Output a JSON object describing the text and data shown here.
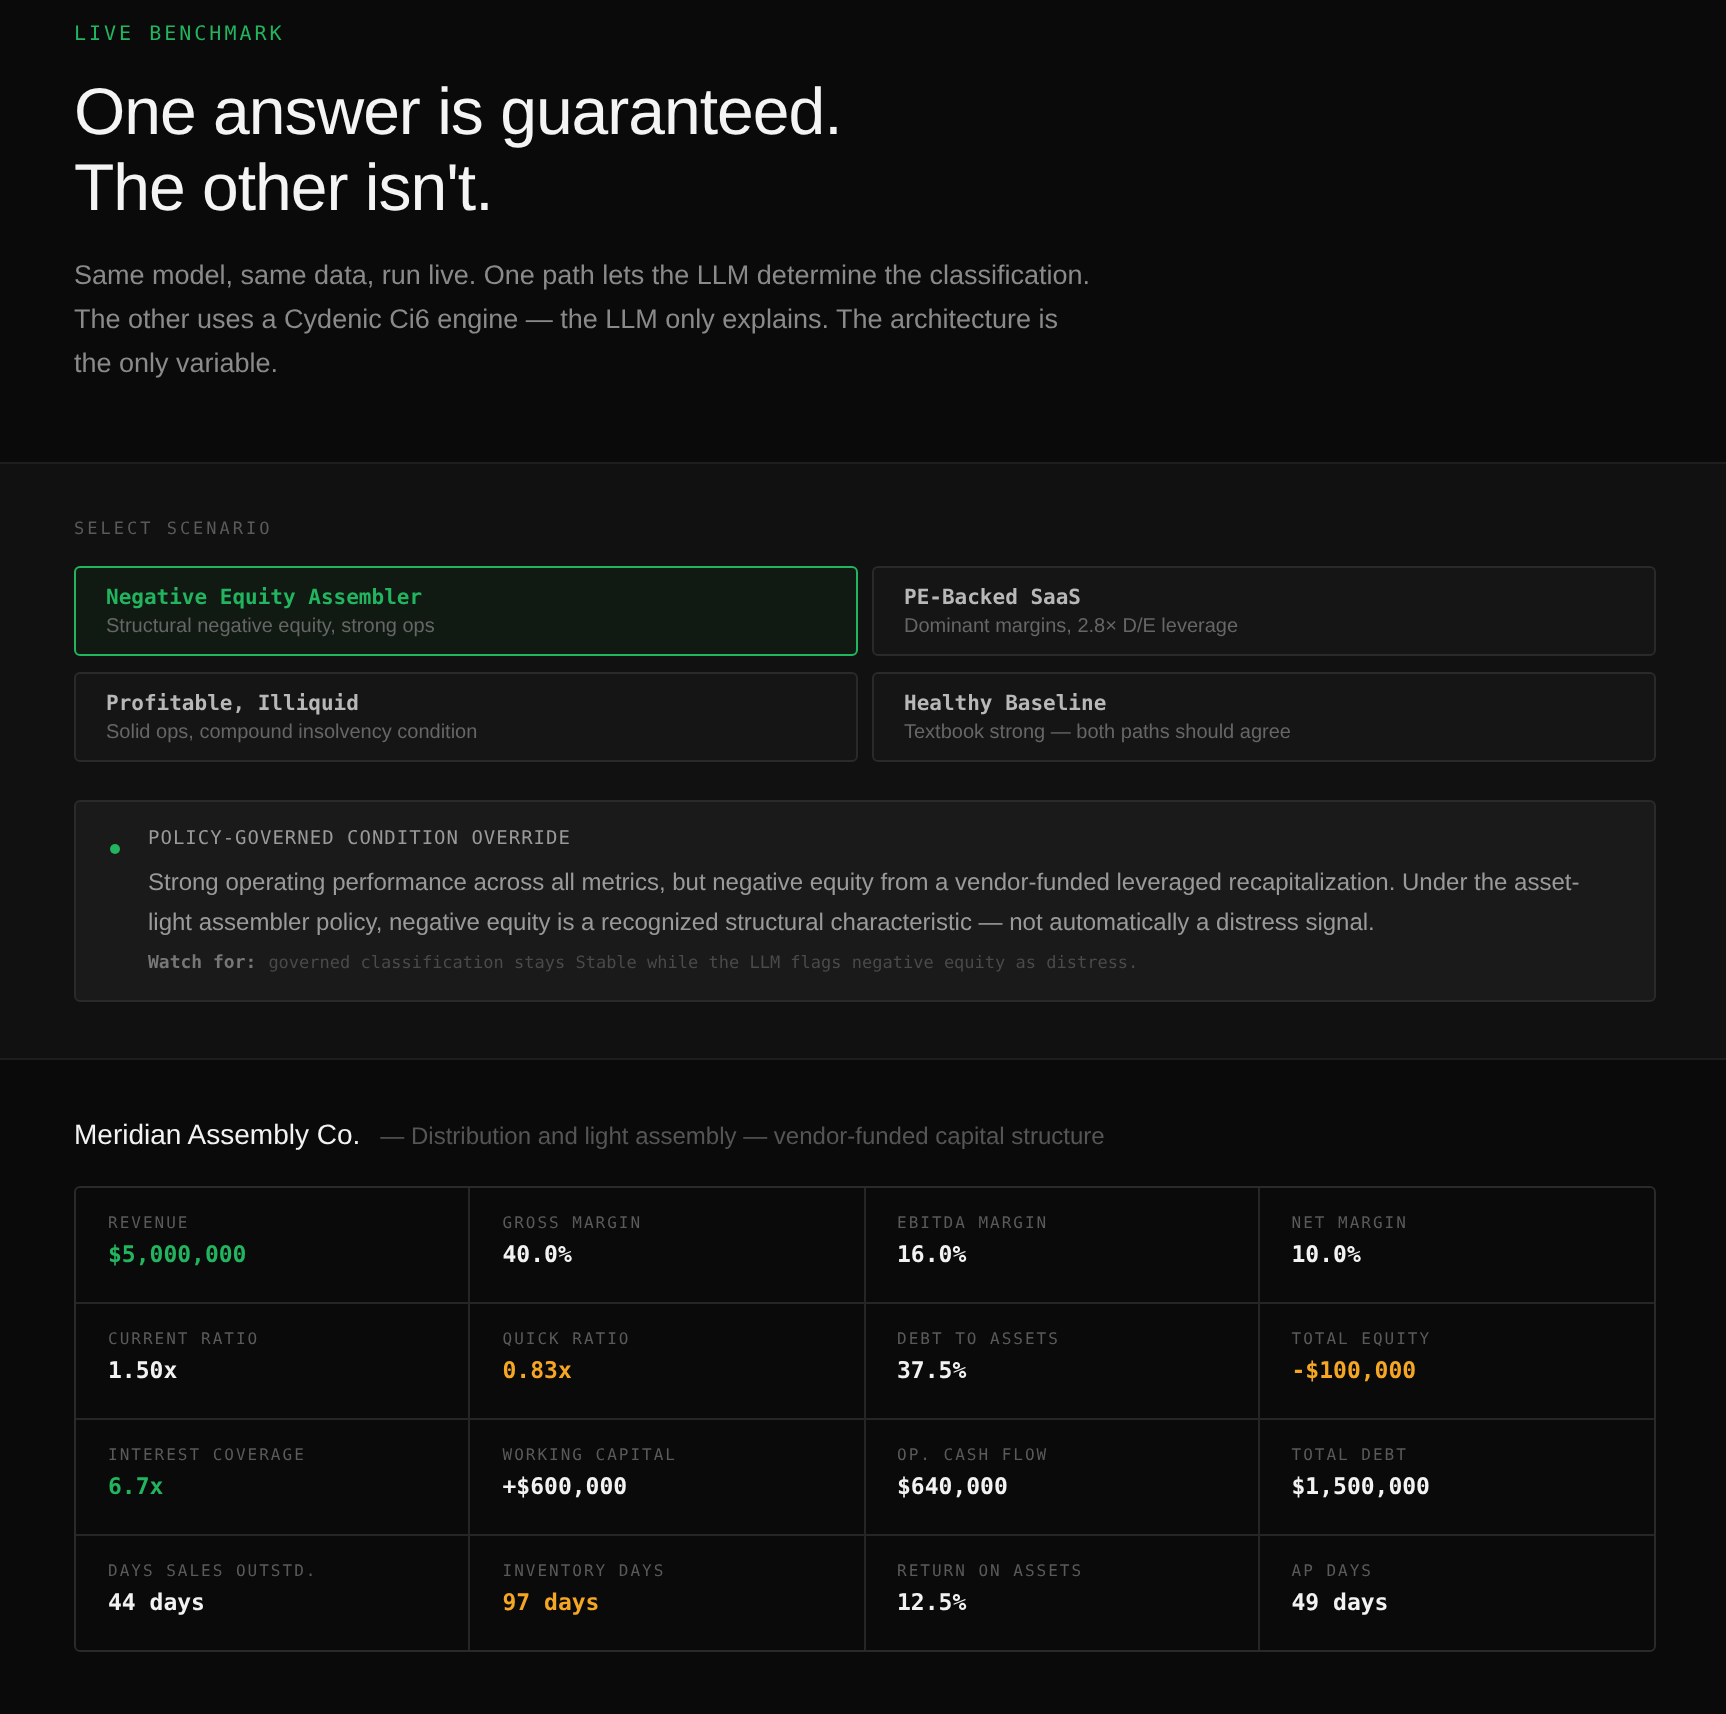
{
  "hero": {
    "eyebrow": "LIVE BENCHMARK",
    "title_lines": [
      "One answer is guaranteed.",
      "The other isn't."
    ],
    "intro": "Same model, same data, run live. One path lets the LLM determine the classification. The other uses a Cydenic Ci6 engine — the LLM only explains. The architecture is the only variable."
  },
  "scenarios": {
    "label": "SELECT SCENARIO",
    "items": [
      {
        "title": "Negative Equity Assembler",
        "subtitle": "Structural negative equity, strong ops",
        "selected": true
      },
      {
        "title": "PE-Backed SaaS",
        "subtitle": "Dominant margins, 2.8× D/E leverage",
        "selected": false
      },
      {
        "title": "Profitable, Illiquid",
        "subtitle": "Solid ops, compound insolvency condition",
        "selected": false
      },
      {
        "title": "Healthy Baseline",
        "subtitle": "Textbook strong — both paths should agree",
        "selected": false
      }
    ]
  },
  "policy": {
    "color": "#22b45e",
    "heading": "POLICY-GOVERNED CONDITION OVERRIDE",
    "body": "Strong operating performance across all metrics, but negative equity from a vendor-funded leveraged recapitalization. Under the asset-light assembler policy, negative equity is a recognized structural characteristic — not automatically a distress signal.",
    "watch_label": "Watch for:",
    "watch_text": "governed classification stays Stable while the LLM flags negative equity as distress."
  },
  "company": {
    "name": "Meridian Assembly Co.",
    "description": "— Distribution and light assembly — vendor-funded capital structure"
  },
  "metrics": [
    {
      "label": "REVENUE",
      "value": "$5,000,000",
      "color": "#22b45e"
    },
    {
      "label": "GROSS MARGIN",
      "value": "40.0%",
      "color": "#f2f2f2"
    },
    {
      "label": "EBITDA MARGIN",
      "value": "16.0%",
      "color": "#f2f2f2"
    },
    {
      "label": "NET MARGIN",
      "value": "10.0%",
      "color": "#f2f2f2"
    },
    {
      "label": "CURRENT RATIO",
      "value": "1.50x",
      "color": "#f2f2f2"
    },
    {
      "label": "QUICK RATIO",
      "value": "0.83x",
      "color": "#f5a623"
    },
    {
      "label": "DEBT TO ASSETS",
      "value": "37.5%",
      "color": "#f2f2f2"
    },
    {
      "label": "TOTAL EQUITY",
      "value": "-$100,000",
      "color": "#f5a623"
    },
    {
      "label": "INTEREST COVERAGE",
      "value": "6.7x",
      "color": "#22b45e"
    },
    {
      "label": "WORKING CAPITAL",
      "value": "+$600,000",
      "color": "#f2f2f2"
    },
    {
      "label": "OP. CASH FLOW",
      "value": "$640,000",
      "color": "#f2f2f2"
    },
    {
      "label": "TOTAL DEBT",
      "value": "$1,500,000",
      "color": "#f2f2f2"
    },
    {
      "label": "DAYS SALES OUTSTD.",
      "value": "44 days",
      "color": "#f2f2f2"
    },
    {
      "label": "INVENTORY DAYS",
      "value": "97 days",
      "color": "#f5a623"
    },
    {
      "label": "RETURN ON ASSETS",
      "value": "12.5%",
      "color": "#f2f2f2"
    },
    {
      "label": "AP DAYS",
      "value": "49 days",
      "color": "#f2f2f2"
    }
  ]
}
